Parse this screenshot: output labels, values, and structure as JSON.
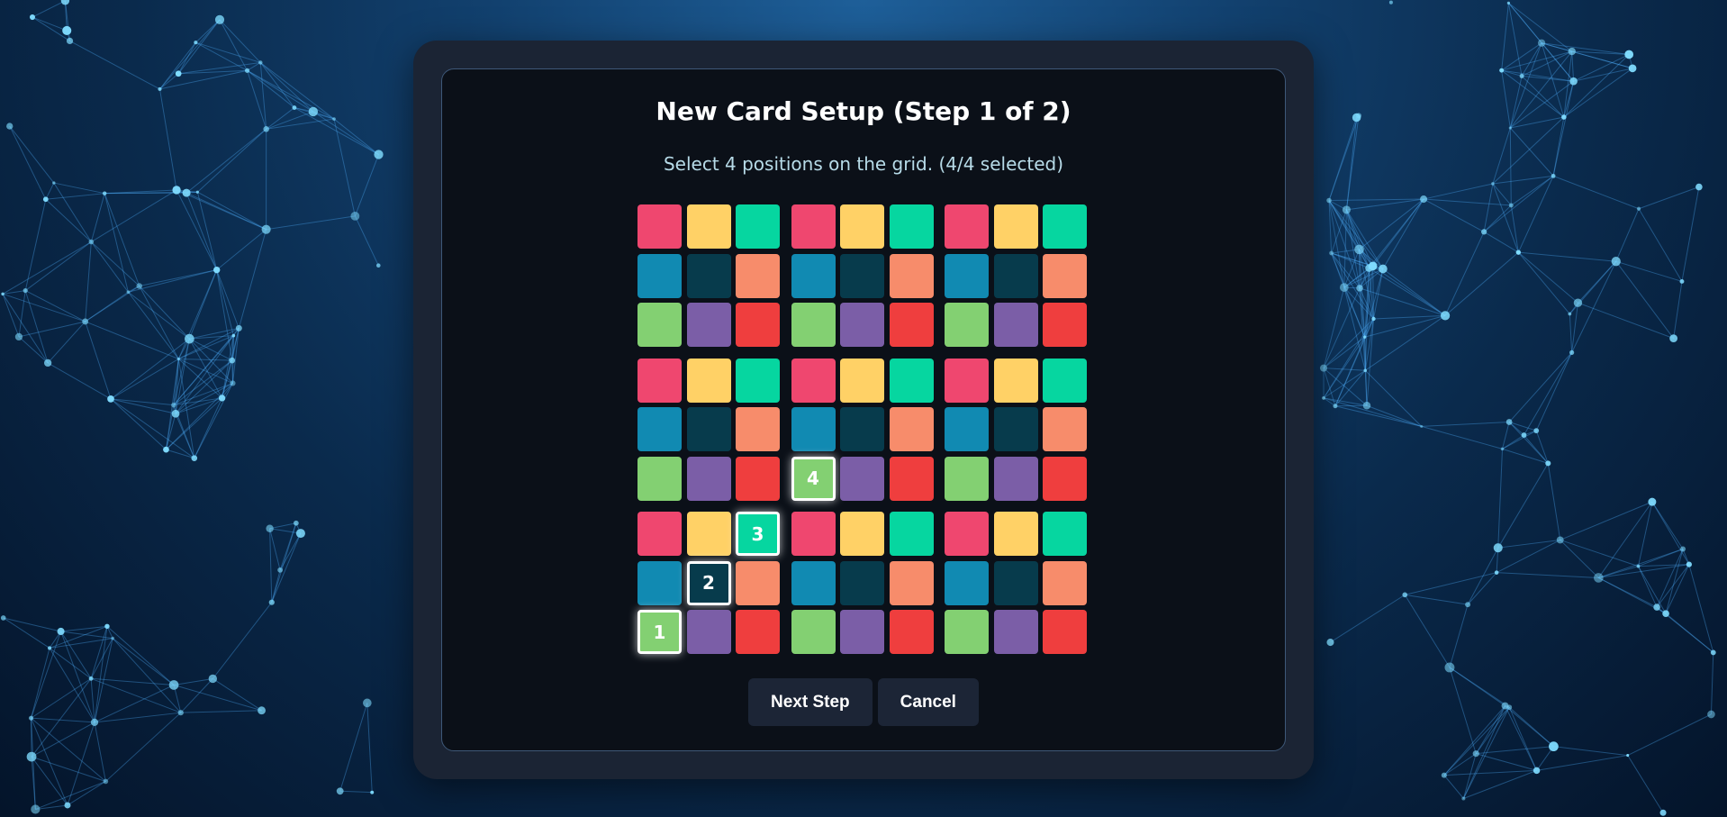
{
  "dialog": {
    "title": "New Card Setup (Step 1 of 2)",
    "subtitle": "Select 4 positions on the grid. (4/4 selected)",
    "buttons": {
      "next_label": "Next Step",
      "cancel_label": "Cancel"
    }
  },
  "grid": {
    "rows": 9,
    "cols": 9,
    "block_palette": [
      [
        "#ef476f",
        "#ffd166",
        "#06d6a0"
      ],
      [
        "#118ab2",
        "#073b4c",
        "#f78c6b"
      ],
      [
        "#83d072",
        "#7b5ea7",
        "#ef3e3e"
      ]
    ],
    "selected": [
      {
        "row": 8,
        "col": 0,
        "order": "1"
      },
      {
        "row": 7,
        "col": 1,
        "order": "2"
      },
      {
        "row": 6,
        "col": 2,
        "order": "3"
      },
      {
        "row": 5,
        "col": 3,
        "order": "4"
      }
    ]
  }
}
